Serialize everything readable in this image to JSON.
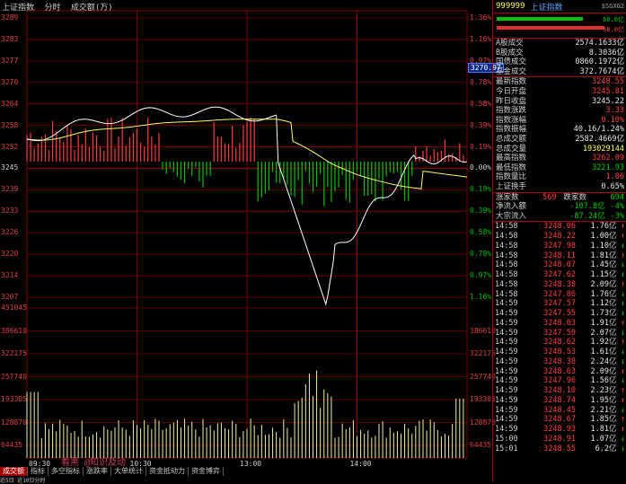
{
  "chart": {
    "title": "上证指数",
    "mode": "分时",
    "volume_label": "成交额(万)",
    "price_tag": "3270.97",
    "price_labels_left": [
      "3289",
      "3283",
      "3277",
      "3270",
      "3264",
      "3258",
      "3252",
      "3245",
      "3239",
      "3233",
      "3226",
      "3220",
      "3214",
      "3207"
    ],
    "pct_labels_right": [
      "1.36%",
      "1.16%",
      "0.97%",
      "0.78%",
      "0.58%",
      "0.39%",
      "0.19%",
      "0.00%",
      "0.19%",
      "0.39%",
      "0.58%",
      "0.78%",
      "0.97%",
      "1.16%"
    ],
    "vol_labels_left": [
      "451045",
      "386610",
      "322175",
      "257740",
      "193305",
      "128870",
      "64435"
    ],
    "vol_labels_right": [
      "386610",
      "322175",
      "257740",
      "193305",
      "128870",
      "64435"
    ],
    "time_labels": [
      "09:30",
      "10:30",
      "13:00",
      "14:00"
    ],
    "tabs": [
      "成交额",
      "指标",
      "多空指标",
      "涨跌率",
      "大单统计",
      "资金抵动力",
      "资金博弈"
    ],
    "bottom_text": "近5日 近10日分时",
    "watermark": "看黑 @知识及动",
    "colors": {
      "up": "#ff3c3c",
      "down": "#00c000",
      "grid": "#7a0000",
      "price_line": "#ffffff",
      "avg_line": "#ffff66",
      "volume": "#f0f0a0"
    }
  },
  "panel": {
    "code": "999999",
    "name": "上证指数",
    "extra": "$SGXG2",
    "bar1_label": "60.0亿",
    "bar2_label": "58.0亿",
    "rows": [
      {
        "k": "A股成交",
        "v": "2574.1633亿",
        "c": "wht"
      },
      {
        "k": "B股成交",
        "v": "8.3036亿",
        "c": "wht"
      },
      {
        "k": "国债成交",
        "v": "0860.1972亿",
        "c": "wht"
      },
      {
        "k": "基金成交",
        "v": "372.7674亿",
        "c": "wht"
      },
      {
        "k": "最新指数",
        "v": "3248.55",
        "c": "red"
      },
      {
        "k": "今日开盘",
        "v": "3245.81",
        "c": "red"
      },
      {
        "k": "昨日收盘",
        "v": "3245.22",
        "c": "wht"
      },
      {
        "k": "指数涨跌",
        "v": "3.33",
        "c": "red"
      },
      {
        "k": "指数涨幅",
        "v": "0.10%",
        "c": "red"
      },
      {
        "k": "指数振幅",
        "v": "40.16/1.24%",
        "c": "wht"
      },
      {
        "k": "总成交额",
        "v": "2582.4669亿",
        "c": "wht"
      },
      {
        "k": "总成交量",
        "v": "193029144",
        "c": "yel"
      },
      {
        "k": "最高指数",
        "v": "3262.09",
        "c": "red"
      },
      {
        "k": "最低指数",
        "v": "3221.93",
        "c": "grn"
      },
      {
        "k": "指数量比",
        "v": "1.06",
        "c": "red"
      },
      {
        "k": "上证换手",
        "v": "0.65%",
        "c": "wht"
      }
    ],
    "up_label": "涨家数",
    "up_count": "569",
    "down_label": "跌家数",
    "down_count": "694",
    "flows": [
      {
        "k": "净流入额",
        "v": "-107.8亿",
        "p": "-4%"
      },
      {
        "k": "大宗流入",
        "v": "-87.24亿",
        "p": "-3%"
      }
    ],
    "ticks": [
      {
        "t": "14:58",
        "p": "3248.06",
        "v": "1.76",
        "a": "↑"
      },
      {
        "t": "14:58",
        "p": "3248.22",
        "v": "1.00",
        "a": "↑"
      },
      {
        "t": "14:58",
        "p": "3247.98",
        "v": "1.10",
        "a": "↓"
      },
      {
        "t": "14:58",
        "p": "3248.11",
        "v": "1.81",
        "a": "↑"
      },
      {
        "t": "14:58",
        "p": "3248.07",
        "v": "1.45",
        "a": "↓"
      },
      {
        "t": "14:58",
        "p": "3247.62",
        "v": "1.15",
        "a": "↓"
      },
      {
        "t": "14:58",
        "p": "3248.38",
        "v": "2.09",
        "a": "↑"
      },
      {
        "t": "14:58",
        "p": "3247.86",
        "v": "1.76",
        "a": "↓"
      },
      {
        "t": "14:59",
        "p": "3247.57",
        "v": "1.12",
        "a": "↓"
      },
      {
        "t": "14:59",
        "p": "3247.55",
        "v": "1.73",
        "a": "↓"
      },
      {
        "t": "14:59",
        "p": "3248.03",
        "v": "1.91",
        "a": "↑"
      },
      {
        "t": "14:59",
        "p": "3247.59",
        "v": "2.07",
        "a": "↓"
      },
      {
        "t": "14:59",
        "p": "3248.62",
        "v": "1.92",
        "a": "↑"
      },
      {
        "t": "14:59",
        "p": "3248.53",
        "v": "1.61",
        "a": "↓"
      },
      {
        "t": "14:59",
        "p": "3248.38",
        "v": "2.24",
        "a": "↓"
      },
      {
        "t": "14:59",
        "p": "3248.63",
        "v": "2.09",
        "a": "↑"
      },
      {
        "t": "14:59",
        "p": "3247.96",
        "v": "1.56",
        "a": "↓"
      },
      {
        "t": "14:59",
        "p": "3248.10",
        "v": "2.23",
        "a": "↑"
      },
      {
        "t": "14:59",
        "p": "3248.74",
        "v": "1.95",
        "a": "↑"
      },
      {
        "t": "14:59",
        "p": "3248.45",
        "v": "2.21",
        "a": "↓"
      },
      {
        "t": "14:59",
        "p": "3248.67",
        "v": "1.85",
        "a": "↑"
      },
      {
        "t": "14:59",
        "p": "3248.93",
        "v": "1.81",
        "a": "↑"
      },
      {
        "t": "15:00",
        "p": "3248.91",
        "v": "1.07",
        "a": "↓"
      },
      {
        "t": "15:01",
        "p": "3248.55",
        "v": "6.2",
        "a": "↓"
      }
    ],
    "unit": "亿"
  }
}
